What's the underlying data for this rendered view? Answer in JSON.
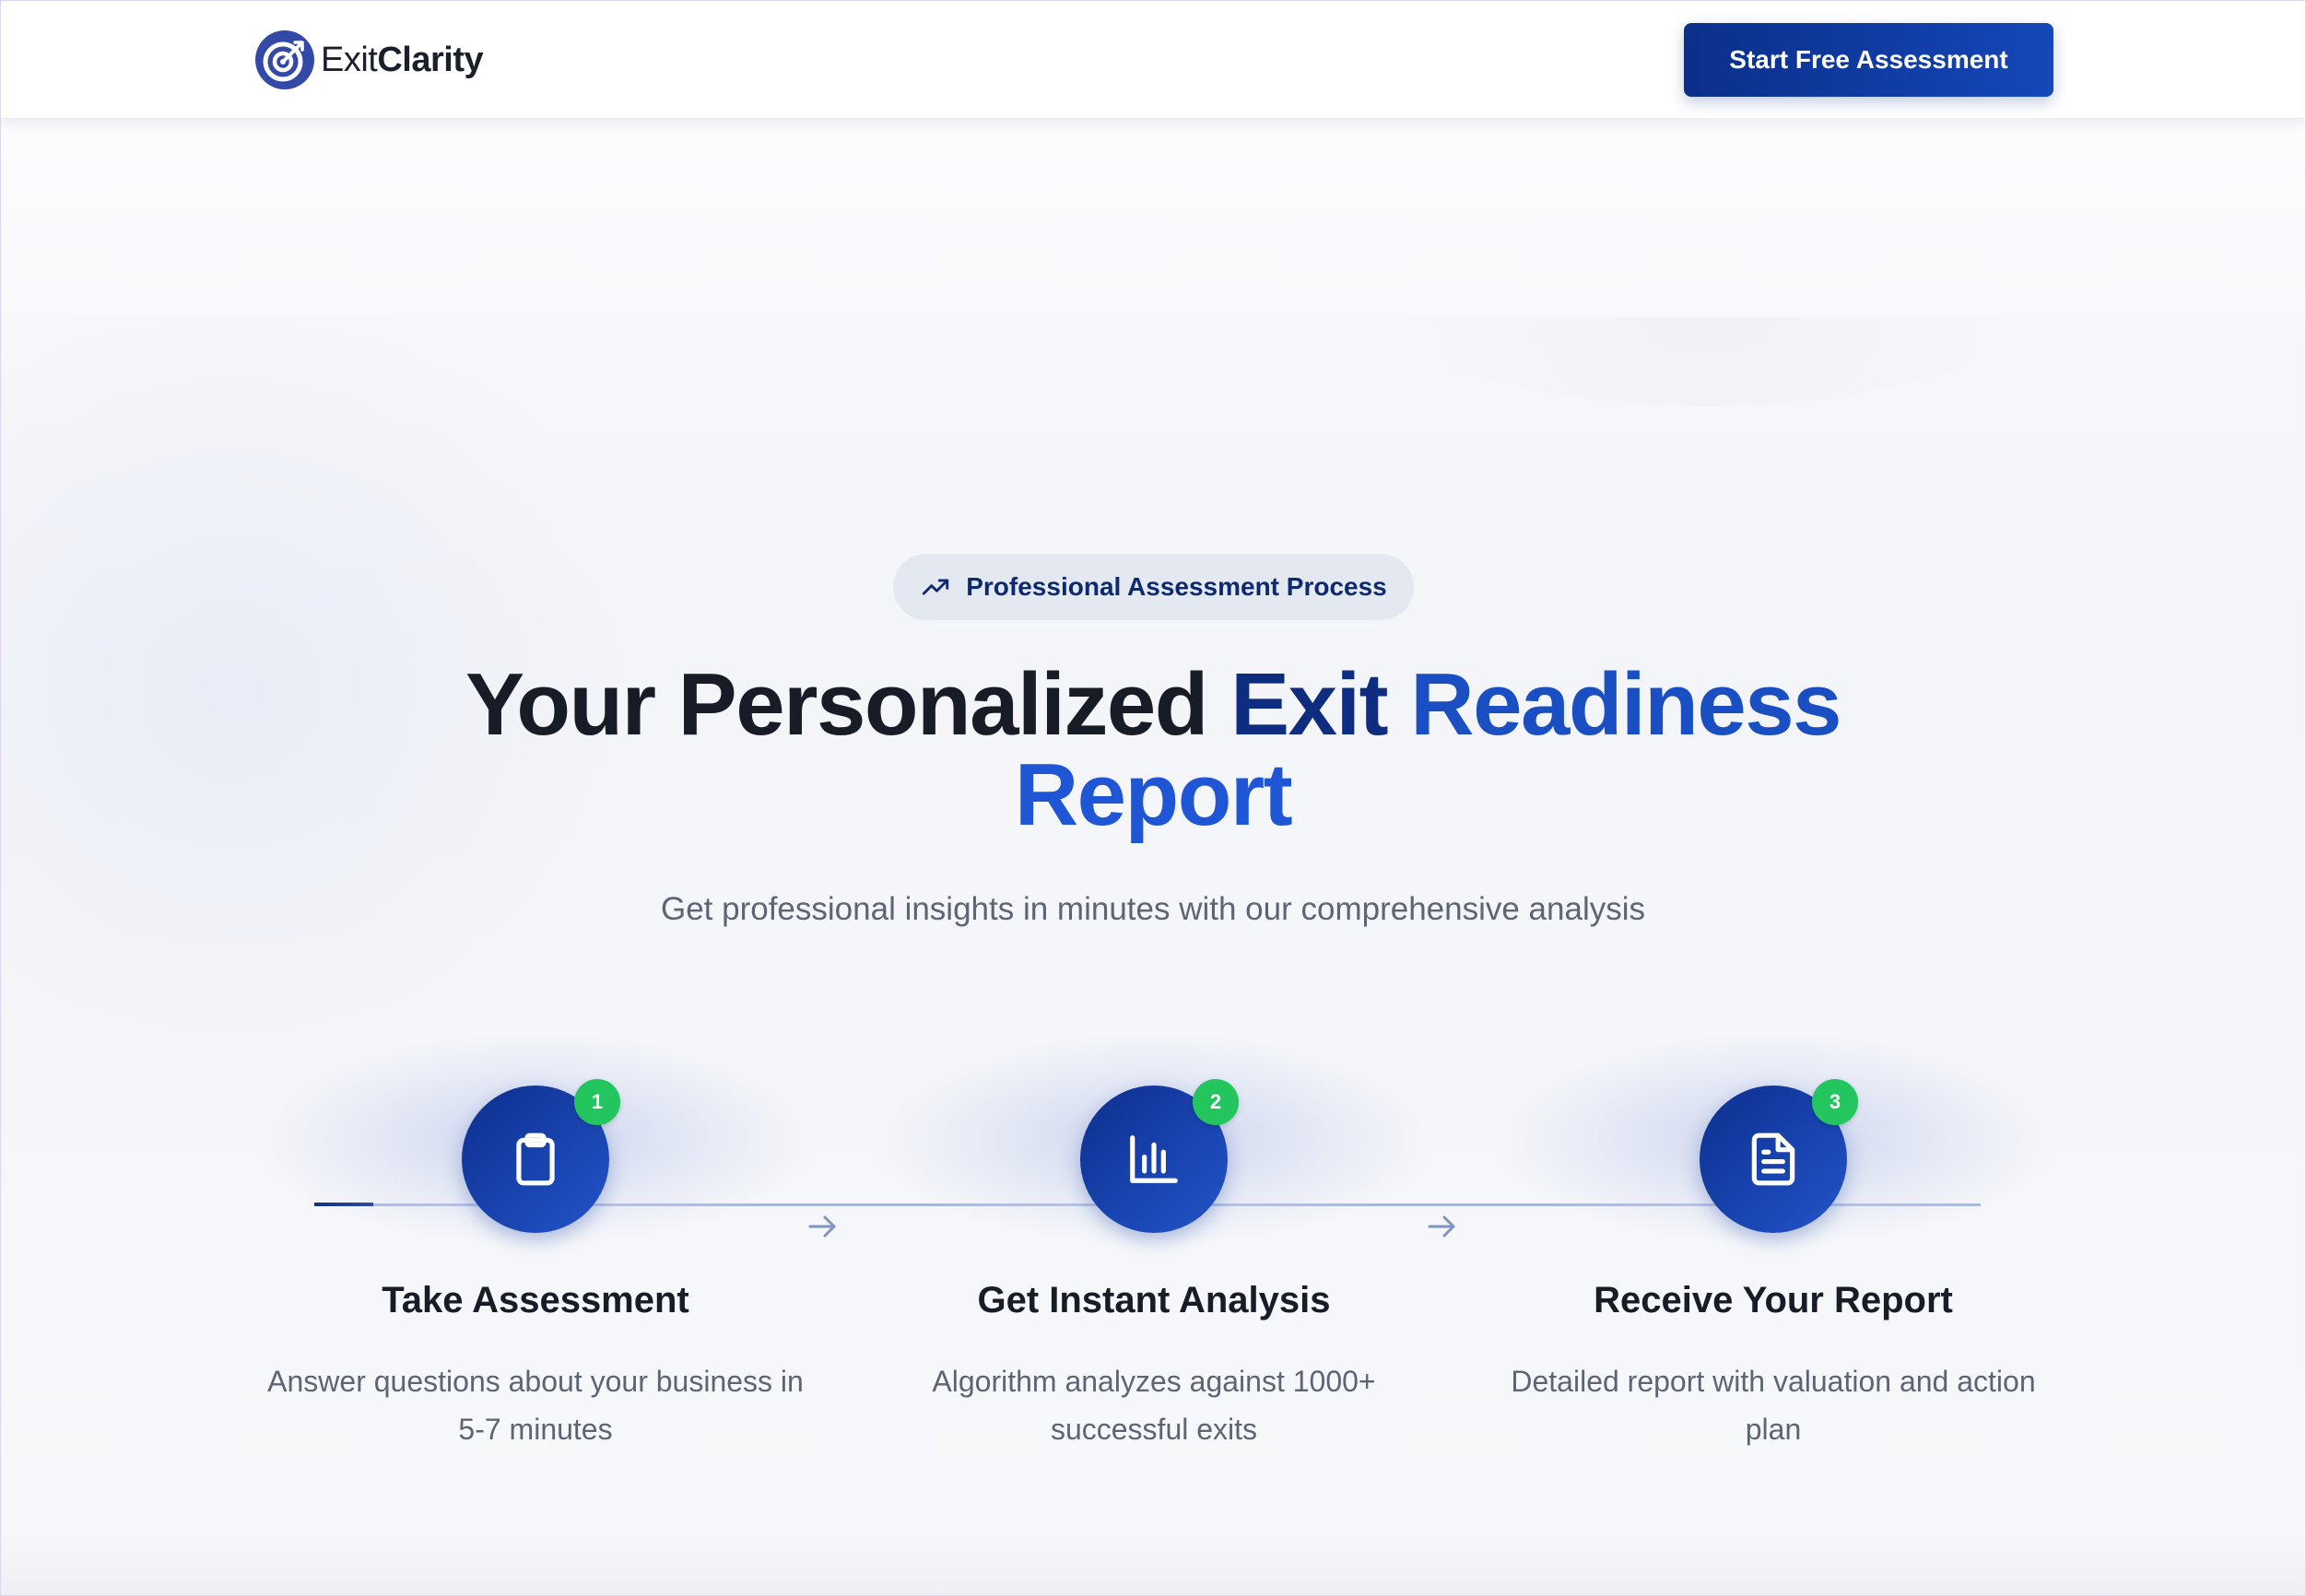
{
  "nav": {
    "logo_text_light": "Exit",
    "logo_text_bold": "Clarity",
    "cta_label": "Start Free Assessment"
  },
  "hero": {
    "pill_icon": "trending-up-icon",
    "pill_label": "Professional Assessment Process",
    "headline_part1": "Your Personalized ",
    "headline_part2": "Exit ",
    "headline_part3": "Readiness",
    "headline_part4": "Report",
    "subtitle": "Get professional insights in minutes with our comprehensive analysis"
  },
  "steps": [
    {
      "number": "1",
      "icon": "clipboard-icon",
      "title": "Take Assessment",
      "description": "Answer questions about your business in 5-7 minutes"
    },
    {
      "number": "2",
      "icon": "bar-chart-icon",
      "title": "Get Instant Analysis",
      "description": "Algorithm analyzes against 1000+ successful exits"
    },
    {
      "number": "3",
      "icon": "document-icon",
      "title": "Receive Your Report",
      "description": "Detailed report with valuation and action plan"
    }
  ],
  "colors": {
    "primary": "#0e2d80",
    "accent": "#1e56d6",
    "badge": "#22c55e",
    "muted_text": "#5d6475"
  }
}
